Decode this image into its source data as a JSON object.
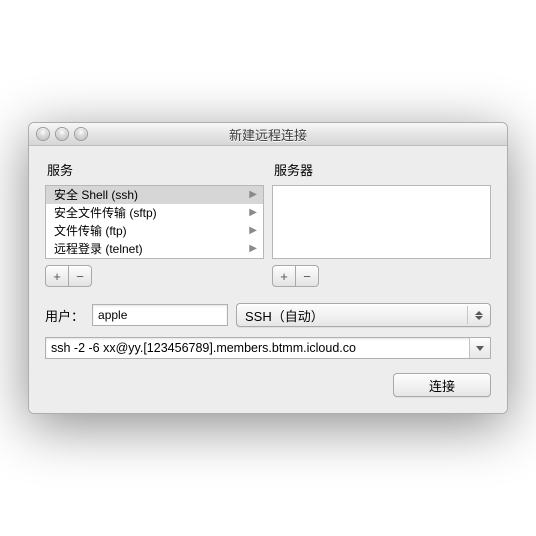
{
  "window": {
    "title": "新建远程连接"
  },
  "columns": {
    "service_label": "服务",
    "server_label": "服务器"
  },
  "services": {
    "items": [
      {
        "label": "安全 Shell (ssh)",
        "selected": true
      },
      {
        "label": "安全文件传输 (sftp)",
        "selected": false
      },
      {
        "label": "文件传输 (ftp)",
        "selected": false
      },
      {
        "label": "远程登录 (telnet)",
        "selected": false
      }
    ]
  },
  "buttons": {
    "plus": "+",
    "minus": "−",
    "connect": "连接"
  },
  "user": {
    "label": "用户：",
    "value": "apple"
  },
  "protocol": {
    "selected": "SSH（自动）"
  },
  "command": {
    "value": "ssh -2 -6 xx@yy.[123456789].members.btmm.icloud.co"
  }
}
